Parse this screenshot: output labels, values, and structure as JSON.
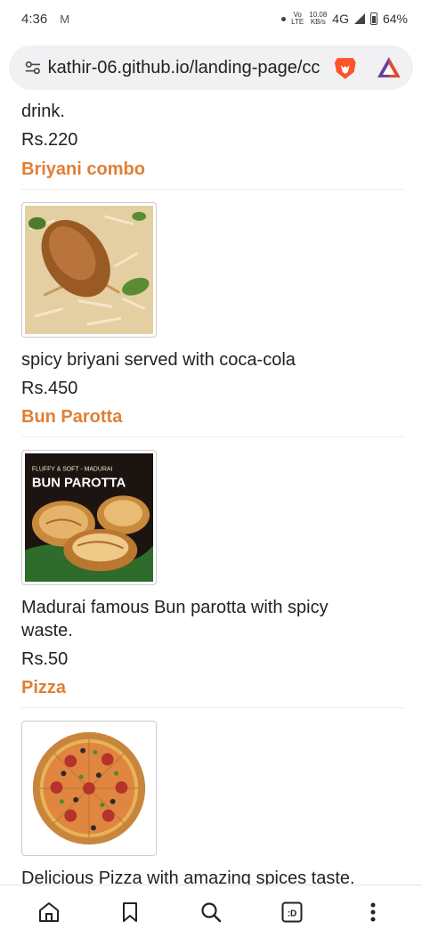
{
  "status_bar": {
    "time": "4:36",
    "mail_glyph": "M",
    "volte_top": "Vo",
    "volte_bottom": "LTE",
    "speed_value": "10.08",
    "speed_unit": "KB/s",
    "network": "4G",
    "battery": "64%"
  },
  "browser": {
    "url": "kathir-06.github.io/landing-page/cc",
    "site_icon": "tune-icon",
    "brave_icon": "brave-lion-icon",
    "rewards_icon": "brave-rewards-icon"
  },
  "content": {
    "top_desc": "drink.",
    "top_price": "Rs.220",
    "items": [
      {
        "title": "Briyani combo",
        "image_icon": "briyani-image",
        "desc": "spicy briyani served with coca-cola",
        "price": "Rs.450"
      },
      {
        "title": "Bun Parotta",
        "image_icon": "bun-parotta-image",
        "image_caption_small": "FLUFFY & SOFT - MADURAI",
        "image_caption_big": "BUN PAROTTA",
        "desc_line1": "Madurai famous Bun parotta with spicy",
        "desc_line2": "waste.",
        "price": "Rs.50"
      },
      {
        "title": "Pizza",
        "image_icon": "pizza-image",
        "desc": "Delicious Pizza with amazing spices taste."
      }
    ]
  },
  "bottom_nav": {
    "items": [
      {
        "icon": "home-icon"
      },
      {
        "icon": "bookmark-icon"
      },
      {
        "icon": "search-icon"
      },
      {
        "icon": "tabs-icon",
        "label": ":D"
      },
      {
        "icon": "more-icon"
      }
    ]
  },
  "colors": {
    "accent": "#e07f34",
    "text": "#222222",
    "url_bar_bg": "#f1f1f4"
  }
}
